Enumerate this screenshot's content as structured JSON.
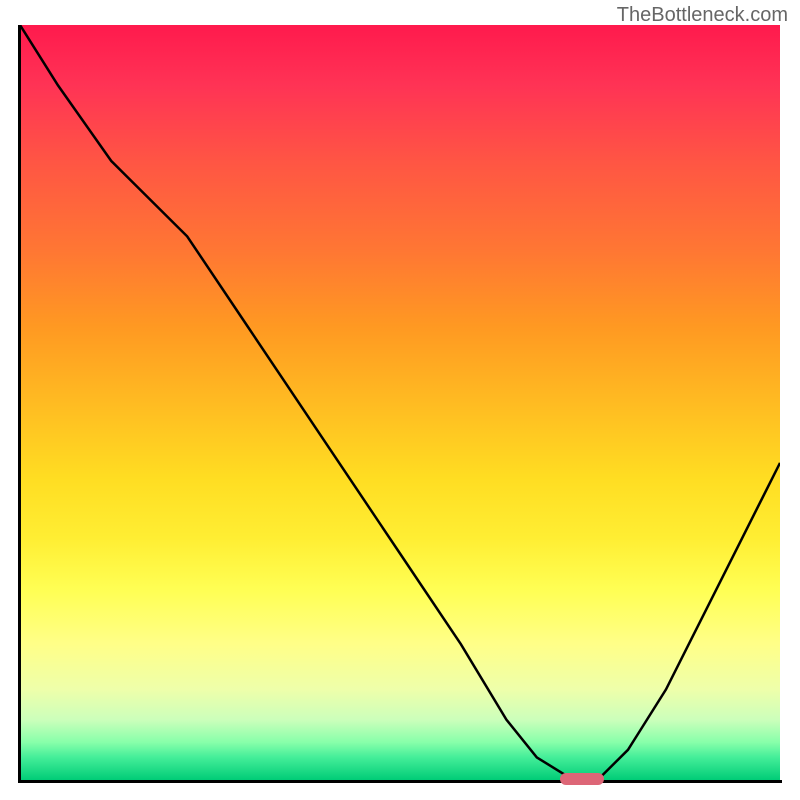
{
  "watermark": "TheBottleneck.com",
  "chart_data": {
    "type": "line",
    "title": "",
    "xlabel": "",
    "ylabel": "",
    "x": [
      0,
      5,
      12,
      22,
      30,
      40,
      50,
      58,
      64,
      68,
      72,
      74,
      76,
      80,
      85,
      90,
      95,
      100
    ],
    "y": [
      100,
      92,
      82,
      72,
      60,
      45,
      30,
      18,
      8,
      3,
      0.5,
      0,
      0,
      4,
      12,
      22,
      32,
      42
    ],
    "xlim": [
      0,
      100
    ],
    "ylim": [
      0,
      100
    ],
    "annotations": [
      {
        "type": "marker",
        "x": 74,
        "y": 0,
        "color": "#dd6677",
        "shape": "pill"
      }
    ],
    "background": "gradient_heatmap_red_to_green_vertical",
    "gradient_stops": [
      {
        "pos": 0.0,
        "color": "#ff1a4d"
      },
      {
        "pos": 0.3,
        "color": "#ff7733"
      },
      {
        "pos": 0.6,
        "color": "#ffdd22"
      },
      {
        "pos": 0.82,
        "color": "#ffff88"
      },
      {
        "pos": 1.0,
        "color": "#00cc77"
      }
    ]
  }
}
